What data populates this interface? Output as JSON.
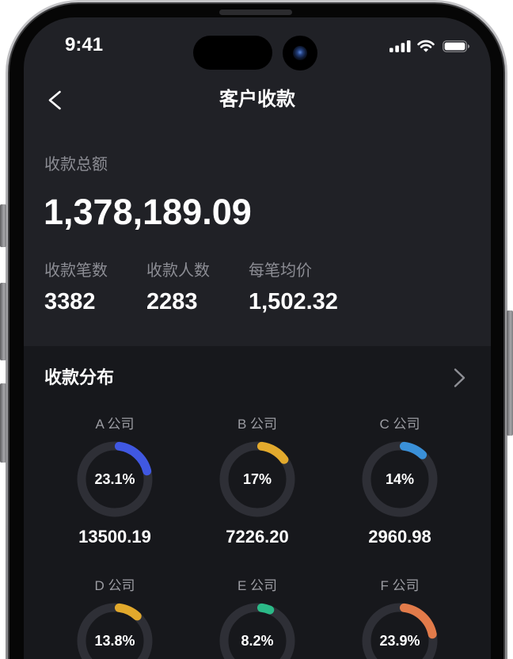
{
  "status_bar": {
    "time": "9:41",
    "icons": [
      "signal-icon",
      "wifi-icon",
      "battery-icon"
    ]
  },
  "nav": {
    "title": "客户收款",
    "back_icon": "chevron-left-icon"
  },
  "summary": {
    "total_label": "收款总额",
    "total_value": "1,378,189.09",
    "stats": [
      {
        "label": "收款笔数",
        "value": "3382"
      },
      {
        "label": "收款人数",
        "value": "2283"
      },
      {
        "label": "每笔均价",
        "value": "1,502.32"
      }
    ]
  },
  "distribution": {
    "title": "收款分布",
    "more_icon": "chevron-right-icon",
    "companies": [
      {
        "name": "A 公司",
        "percent": 23.1,
        "percent_label": "23.1%",
        "amount": "13500.19",
        "color": "#4058e2"
      },
      {
        "name": "B 公司",
        "percent": 17,
        "percent_label": "17%",
        "amount": "7226.20",
        "color": "#e3aa2d"
      },
      {
        "name": "C 公司",
        "percent": 14,
        "percent_label": "14%",
        "amount": "2960.98",
        "color": "#3a90d8"
      },
      {
        "name": "D 公司",
        "percent": 13.8,
        "percent_label": "13.8%",
        "color": "#e2a92c"
      },
      {
        "name": "E 公司",
        "percent": 8.2,
        "percent_label": "8.2%",
        "color": "#2bb987"
      },
      {
        "name": "F 公司",
        "percent": 23.9,
        "percent_label": "23.9%",
        "color": "#e27b4a"
      }
    ]
  },
  "theme": {
    "background_top": "#202126",
    "background_bottom": "#17181c",
    "track": "#2e2f36",
    "text_primary": "#ffffff",
    "text_secondary": "#8c8d94"
  }
}
